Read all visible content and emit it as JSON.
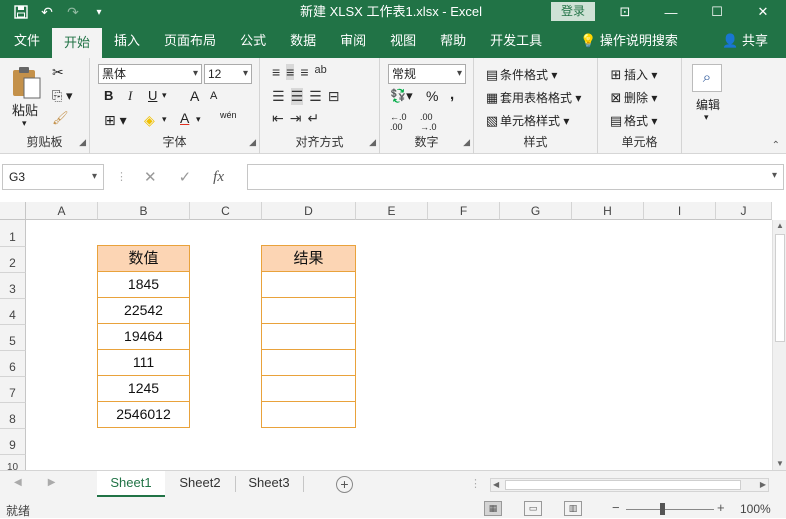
{
  "window": {
    "title": "新建 XLSX 工作表1.xlsx  -  Excel",
    "login_label": "登录",
    "minimize": "—",
    "maximize": "☐",
    "close": "✕",
    "ribbon_display": "⊡"
  },
  "quick_access": {
    "save": "💾",
    "undo": "↶",
    "redo": "↷",
    "customize": "▾"
  },
  "menu": {
    "tabs": [
      "文件",
      "开始",
      "插入",
      "页面布局",
      "公式",
      "数据",
      "审阅",
      "视图",
      "帮助",
      "开发工具"
    ],
    "active": "开始",
    "tell_me": "操作说明搜索",
    "share": "共享"
  },
  "ribbon": {
    "clipboard": {
      "label": "剪贴板",
      "paste": "粘贴"
    },
    "font": {
      "label": "字体",
      "family": "黑体",
      "size": "12",
      "bold": "B",
      "italic": "I",
      "underline": "U",
      "grow": "A",
      "shrink": "A",
      "phonetic": "wén"
    },
    "alignment": {
      "label": "对齐方式"
    },
    "number": {
      "label": "数字",
      "format": "常规",
      "percent": "%",
      "comma": ","
    },
    "styles": {
      "label": "样式",
      "conditional": "条件格式",
      "table": "套用表格格式",
      "cell": "单元格样式"
    },
    "cells": {
      "label": "单元格",
      "insert": "插入",
      "delete": "删除",
      "format": "格式"
    },
    "editing": {
      "label": "编辑"
    }
  },
  "formula_bar": {
    "name_box": "G3",
    "cancel": "✕",
    "enter": "✓",
    "fx": "fx",
    "value": ""
  },
  "sheet": {
    "columns": [
      "A",
      "B",
      "C",
      "D",
      "E",
      "F",
      "G",
      "H",
      "I",
      "J"
    ],
    "rows": [
      "1",
      "2",
      "3",
      "4",
      "5",
      "6",
      "7",
      "8",
      "9",
      "10"
    ],
    "b_header": "数值",
    "d_header": "结果",
    "b_values": [
      "1845",
      "22542",
      "19464",
      "111",
      "1245",
      "2546012"
    ],
    "d_values": [
      "",
      "",
      "",
      "",
      "",
      ""
    ]
  },
  "tabs": {
    "sheets": [
      "Sheet1",
      "Sheet2",
      "Sheet3"
    ],
    "active": "Sheet1",
    "add": "+"
  },
  "status": {
    "text": "就绪",
    "zoom": "100%",
    "zoom_minus": "−",
    "zoom_plus": "+"
  }
}
